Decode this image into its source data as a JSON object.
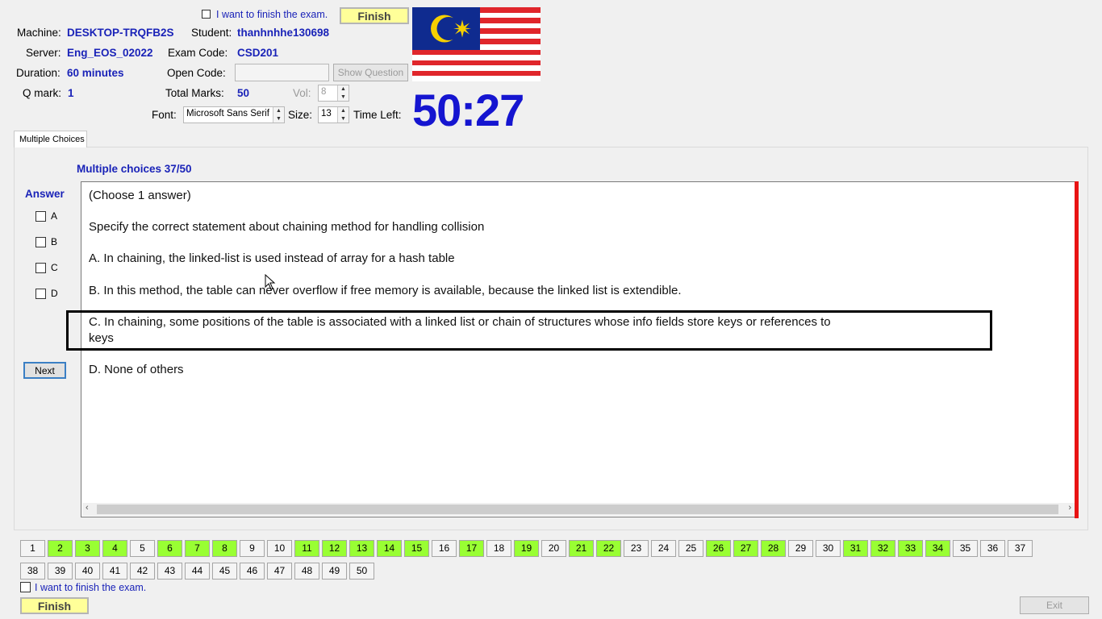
{
  "header": {
    "finish_check_label": "I want to finish the exam.",
    "finish_button": "Finish",
    "machine_label": "Machine:",
    "machine": "DESKTOP-TRQFB2S",
    "student_label": "Student:",
    "student": "thanhnhhe130698",
    "server_label": "Server:",
    "server": "Eng_EOS_02022",
    "exam_code_label": "Exam Code:",
    "exam_code": "CSD201",
    "duration_label": "Duration:",
    "duration": "60 minutes",
    "open_code_label": "Open Code:",
    "open_code": "",
    "show_question": "Show Question",
    "qmark_label": "Q mark:",
    "qmark": "1",
    "total_marks_label": "Total Marks:",
    "total_marks": "50",
    "vol_label": "Vol:",
    "vol": "8",
    "font_label": "Font:",
    "font_value": "Microsoft Sans Serif",
    "size_label": "Size:",
    "size_value": "13",
    "time_left_label": "Time Left:",
    "time_left": "50:27",
    "flag_icon": "malaysia-flag"
  },
  "tab": {
    "label": "Multiple Choices"
  },
  "question": {
    "heading": "Multiple choices 37/50",
    "answer_label": "Answer",
    "options": [
      "A",
      "B",
      "C",
      "D"
    ],
    "next_button": "Next",
    "lines": [
      "(Choose 1 answer)",
      "Specify the correct statement about chaining method for handling collision",
      "A.  In chaining, the linked-list is used instead of array for a  hash table",
      "B.  In this method, the table can never overflow if free memory is available, because the linked list is extendible.",
      "C.  In chaining, some positions of the table is associated with a linked list or chain of structures whose info fields store keys or references to",
      "keys",
      "D.  None of  others"
    ]
  },
  "navigator": {
    "row1": [
      {
        "n": "1",
        "done": false
      },
      {
        "n": "2",
        "done": true
      },
      {
        "n": "3",
        "done": true
      },
      {
        "n": "4",
        "done": true
      },
      {
        "n": "5",
        "done": false
      },
      {
        "n": "6",
        "done": true
      },
      {
        "n": "7",
        "done": true
      },
      {
        "n": "8",
        "done": true
      },
      {
        "n": "9",
        "done": false
      },
      {
        "n": "10",
        "done": false
      },
      {
        "n": "11",
        "done": true
      },
      {
        "n": "12",
        "done": true
      },
      {
        "n": "13",
        "done": true
      },
      {
        "n": "14",
        "done": true
      },
      {
        "n": "15",
        "done": true
      },
      {
        "n": "16",
        "done": false
      },
      {
        "n": "17",
        "done": true
      },
      {
        "n": "18",
        "done": false
      },
      {
        "n": "19",
        "done": true
      },
      {
        "n": "20",
        "done": false
      },
      {
        "n": "21",
        "done": true
      },
      {
        "n": "22",
        "done": true
      },
      {
        "n": "23",
        "done": false
      },
      {
        "n": "24",
        "done": false
      },
      {
        "n": "25",
        "done": false
      },
      {
        "n": "26",
        "done": true
      },
      {
        "n": "27",
        "done": true
      },
      {
        "n": "28",
        "done": true
      },
      {
        "n": "29",
        "done": false
      },
      {
        "n": "30",
        "done": false
      },
      {
        "n": "31",
        "done": true
      },
      {
        "n": "32",
        "done": true
      },
      {
        "n": "33",
        "done": true
      },
      {
        "n": "34",
        "done": true
      },
      {
        "n": "35",
        "done": false
      },
      {
        "n": "36",
        "done": false
      },
      {
        "n": "37",
        "done": false
      }
    ],
    "row2": [
      {
        "n": "38",
        "done": false
      },
      {
        "n": "39",
        "done": false
      },
      {
        "n": "40",
        "done": false
      },
      {
        "n": "41",
        "done": false
      },
      {
        "n": "42",
        "done": false
      },
      {
        "n": "43",
        "done": false
      },
      {
        "n": "44",
        "done": false
      },
      {
        "n": "45",
        "done": false
      },
      {
        "n": "46",
        "done": false
      },
      {
        "n": "47",
        "done": false
      },
      {
        "n": "48",
        "done": false
      },
      {
        "n": "49",
        "done": false
      },
      {
        "n": "50",
        "done": false
      }
    ],
    "done_color": "#99ff33"
  },
  "footer": {
    "finish_check_label": "I want to finish the exam.",
    "finish_button": "Finish",
    "exit_button": "Exit"
  }
}
